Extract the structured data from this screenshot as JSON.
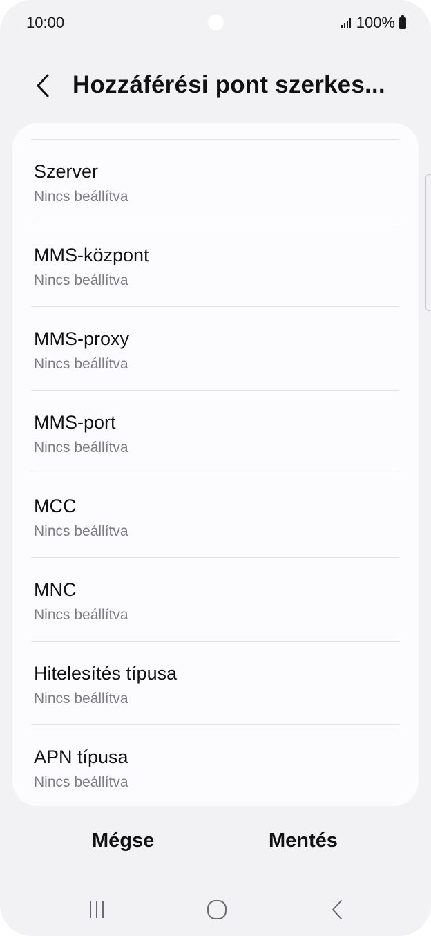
{
  "status_bar": {
    "time": "10:00",
    "battery": "100%"
  },
  "header": {
    "title": "Hozzáférési pont szerkes..."
  },
  "items": [
    {
      "title": "Szerver",
      "subtitle": "Nincs beállítva"
    },
    {
      "title": "MMS-központ",
      "subtitle": "Nincs beállítva"
    },
    {
      "title": "MMS-proxy",
      "subtitle": "Nincs beállítva"
    },
    {
      "title": "MMS-port",
      "subtitle": "Nincs beállítva"
    },
    {
      "title": "MCC",
      "subtitle": "Nincs beállítva"
    },
    {
      "title": "MNC",
      "subtitle": "Nincs beállítva"
    },
    {
      "title": "Hitelesítés típusa",
      "subtitle": "Nincs beállítva"
    },
    {
      "title": "APN típusa",
      "subtitle": "Nincs beállítva"
    }
  ],
  "actions": {
    "cancel_label": "Mégse",
    "save_label": "Mentés"
  },
  "icons": {
    "back": "chevron-left-icon",
    "signal": "signal-icon",
    "battery": "battery-icon",
    "nav_recents": "recents-icon",
    "nav_home": "home-icon",
    "nav_back": "back-icon"
  },
  "colors": {
    "background": "#f2f2f4",
    "card": "#fcfcfe",
    "text_primary": "#111111",
    "text_secondary": "#7c7c80",
    "divider": "#e3e3e6"
  }
}
